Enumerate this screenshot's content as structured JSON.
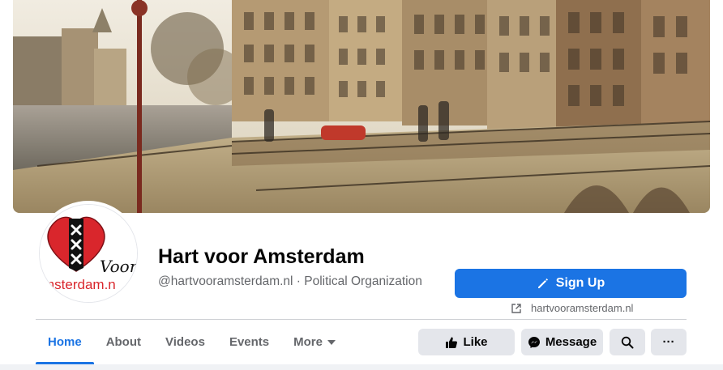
{
  "page": {
    "name": "Hart voor Amsterdam",
    "handle_category": "@hartvooramsterdam.nl · Political Organization"
  },
  "logo": {
    "script_text": "Voor",
    "bottom_text": "msterdam.n"
  },
  "primary_action": {
    "label": "Sign Up",
    "icon": "pencil-icon"
  },
  "website": {
    "label": "hartvooramsterdam.nl",
    "icon": "external-link-icon"
  },
  "tabs": [
    {
      "label": "Home",
      "active": true
    },
    {
      "label": "About",
      "active": false
    },
    {
      "label": "Videos",
      "active": false
    },
    {
      "label": "Events",
      "active": false
    },
    {
      "label": "More",
      "active": false,
      "dropdown": true
    }
  ],
  "actions": {
    "like": {
      "label": "Like",
      "icon": "thumbs-up-icon"
    },
    "message": {
      "label": "Message",
      "icon": "messenger-icon"
    },
    "search": {
      "icon": "search-icon"
    },
    "more": {
      "label": "···",
      "icon": "more-dots-icon"
    }
  },
  "colors": {
    "accent": "#1b74e4",
    "heart": "#d9262c",
    "button_grey": "#e4e6eb",
    "secondary_text": "#65676b"
  }
}
